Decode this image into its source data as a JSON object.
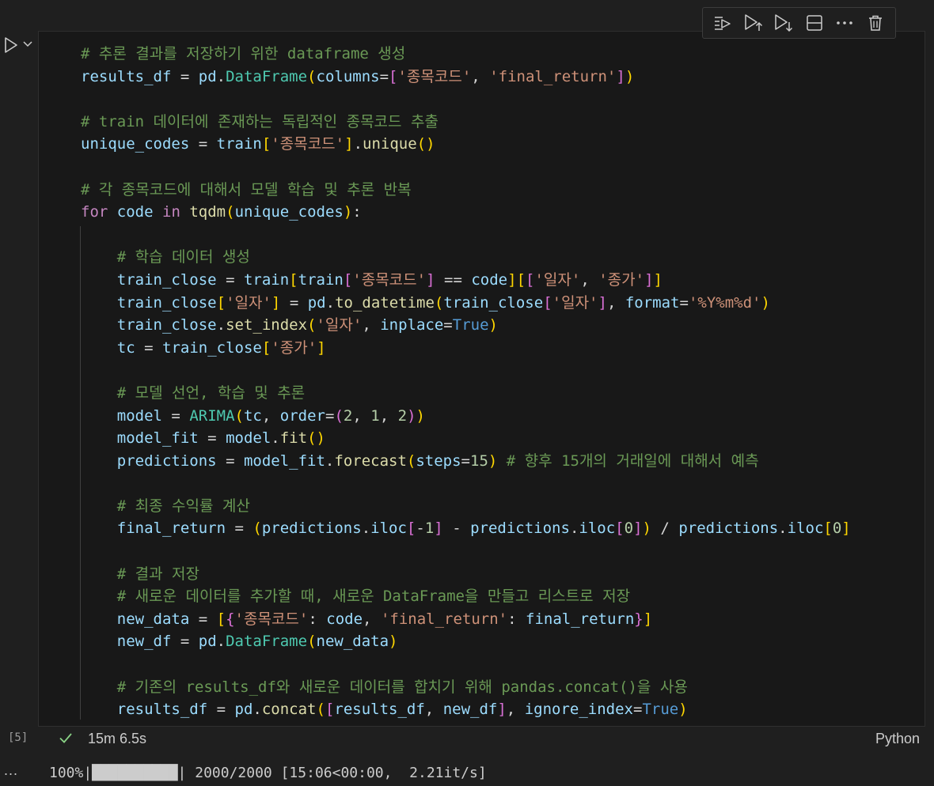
{
  "cell": {
    "execution_count": "[5]",
    "status": "success",
    "exec_time": "15m 6.5s",
    "language": "Python"
  },
  "toolbar": {
    "buttons": [
      "run-by-line",
      "execute-above",
      "execute-below",
      "split-cell",
      "more-actions",
      "delete-cell"
    ]
  },
  "code_lines": [
    "# 추론 결과를 저장하기 위한 dataframe 생성",
    "results_df = pd.DataFrame(columns=['종목코드', 'final_return'])",
    "",
    "# train 데이터에 존재하는 독립적인 종목코드 추출",
    "unique_codes = train['종목코드'].unique()",
    "",
    "# 각 종목코드에 대해서 모델 학습 및 추론 반복",
    "for code in tqdm(unique_codes):",
    "",
    "    # 학습 데이터 생성",
    "    train_close = train[train['종목코드'] == code][['일자', '종가']]",
    "    train_close['일자'] = pd.to_datetime(train_close['일자'], format='%Y%m%d')",
    "    train_close.set_index('일자', inplace=True)",
    "    tc = train_close['종가']",
    "",
    "    # 모델 선언, 학습 및 추론",
    "    model = ARIMA(tc, order=(2, 1, 2))",
    "    model_fit = model.fit()",
    "    predictions = model_fit.forecast(steps=15) # 향후 15개의 거래일에 대해서 예측",
    "",
    "    # 최종 수익률 계산",
    "    final_return = (predictions.iloc[-1] - predictions.iloc[0]) / predictions.iloc[0]",
    "",
    "    # 결과 저장",
    "    # 새로운 데이터를 추가할 때, 새로운 DataFrame을 만들고 리스트로 저장",
    "    new_data = [{'종목코드': code, 'final_return': final_return}]",
    "    new_df = pd.DataFrame(new_data)",
    "",
    "    # 기존의 results_df와 새로운 데이터를 합치기 위해 pandas.concat()을 사용",
    "    results_df = pd.concat([results_df, new_df], ignore_index=True)"
  ],
  "output": {
    "more": "...",
    "progress_text": "100%|██████████| 2000/2000 [15:06<00:00,  2.21it/s]",
    "progress": 1.0
  }
}
